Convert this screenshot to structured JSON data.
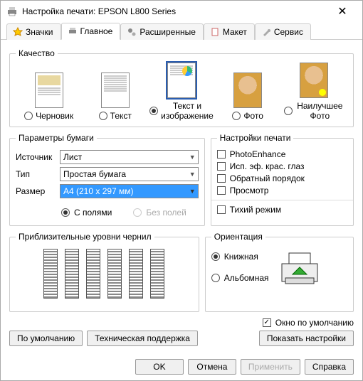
{
  "window": {
    "title": "Настройка печати: EPSON L800 Series"
  },
  "tabs": {
    "icons": "Значки",
    "main": "Главное",
    "advanced": "Расширенные",
    "layout": "Макет",
    "service": "Сервис"
  },
  "quality": {
    "legend": "Качество",
    "draft": "Черновик",
    "text": "Текст",
    "text_image": "Текст и изображение",
    "photo": "Фото",
    "best_photo": "Наилучшее Фото",
    "selected": "text_image"
  },
  "paper": {
    "legend": "Параметры бумаги",
    "source_label": "Источник",
    "source_value": "Лист",
    "type_label": "Тип",
    "type_value": "Простая бумага",
    "size_label": "Размер",
    "size_value": "A4 (210 x 297 мм)",
    "with_margins": "С полями",
    "borderless": "Без полей"
  },
  "printopts": {
    "legend": "Настройки печати",
    "photoenhance": "PhotoEnhance",
    "redeye": "Исп. эф. крас. глаз",
    "reverse": "Обратный порядок",
    "preview": "Просмотр",
    "quiet": "Тихий режим"
  },
  "ink": {
    "legend": "Приблизительные уровни чернил"
  },
  "orientation": {
    "legend": "Ориентация",
    "portrait": "Книжная",
    "landscape": "Альбомная"
  },
  "default_window": "Окно по умолчанию",
  "buttons": {
    "defaults": "По умолчанию",
    "support": "Техническая поддержка",
    "show_settings": "Показать настройки",
    "ok": "OK",
    "cancel": "Отмена",
    "apply": "Применить",
    "help": "Справка"
  }
}
